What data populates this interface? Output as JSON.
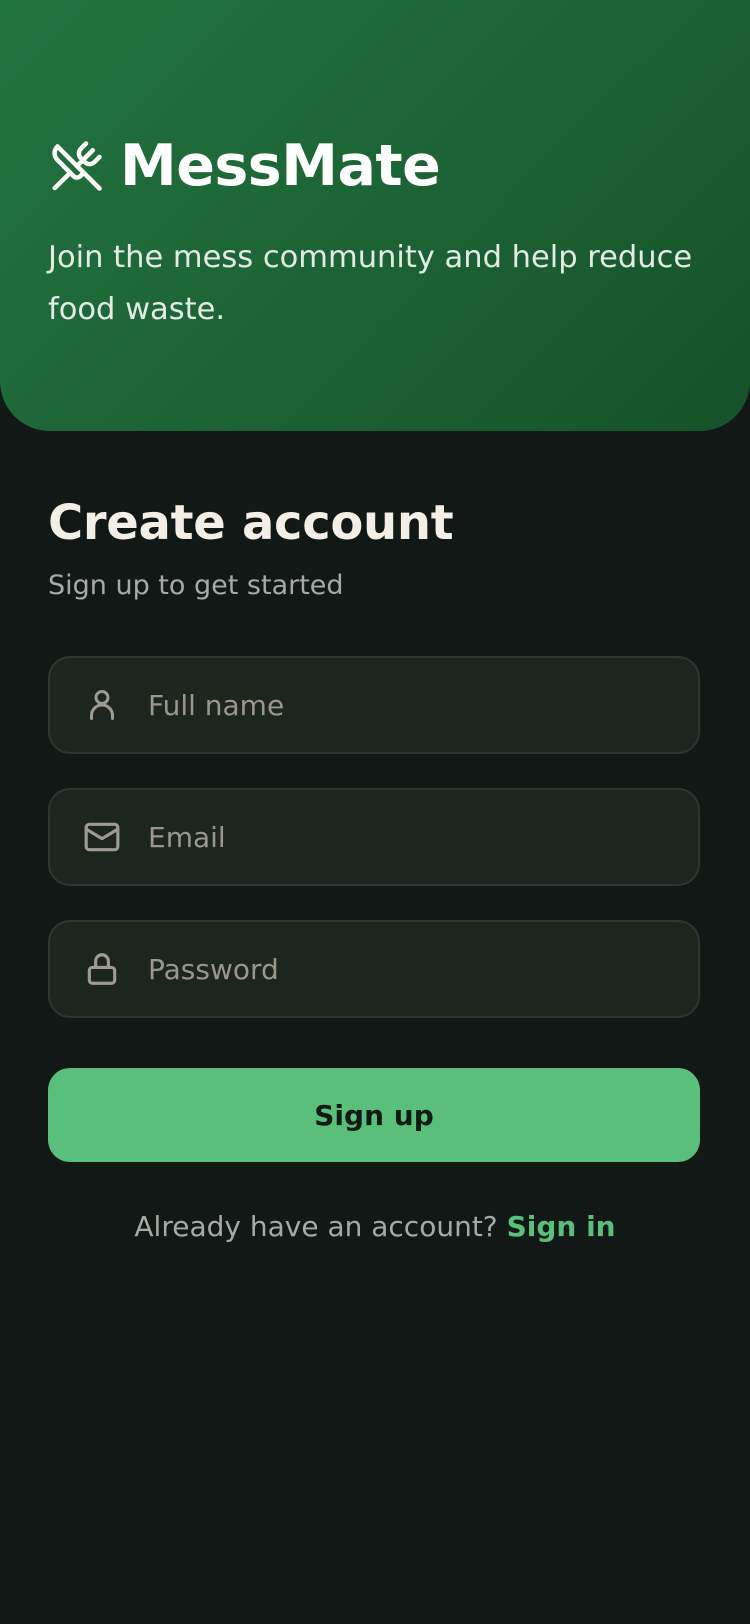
{
  "brand": {
    "name": "MessMate",
    "icon": "utensils-crossed-icon",
    "tagline": "Join the mess community and help reduce food waste."
  },
  "form": {
    "title": "Create account",
    "subtitle": "Sign up to get started",
    "full_name": {
      "placeholder": "Full name",
      "value": "",
      "icon": "user-icon"
    },
    "email": {
      "placeholder": "Email",
      "value": "",
      "icon": "mail-icon"
    },
    "password": {
      "placeholder": "Password",
      "value": "",
      "icon": "lock-icon"
    },
    "submit_label": "Sign up"
  },
  "footer": {
    "prompt": "Already have an account?",
    "link_label": "Sign in"
  },
  "colors": {
    "accent": "#5bbf7c",
    "hero_start": "#22743f",
    "hero_end": "#155229",
    "background": "#111815",
    "field_background": "#1d251f"
  }
}
